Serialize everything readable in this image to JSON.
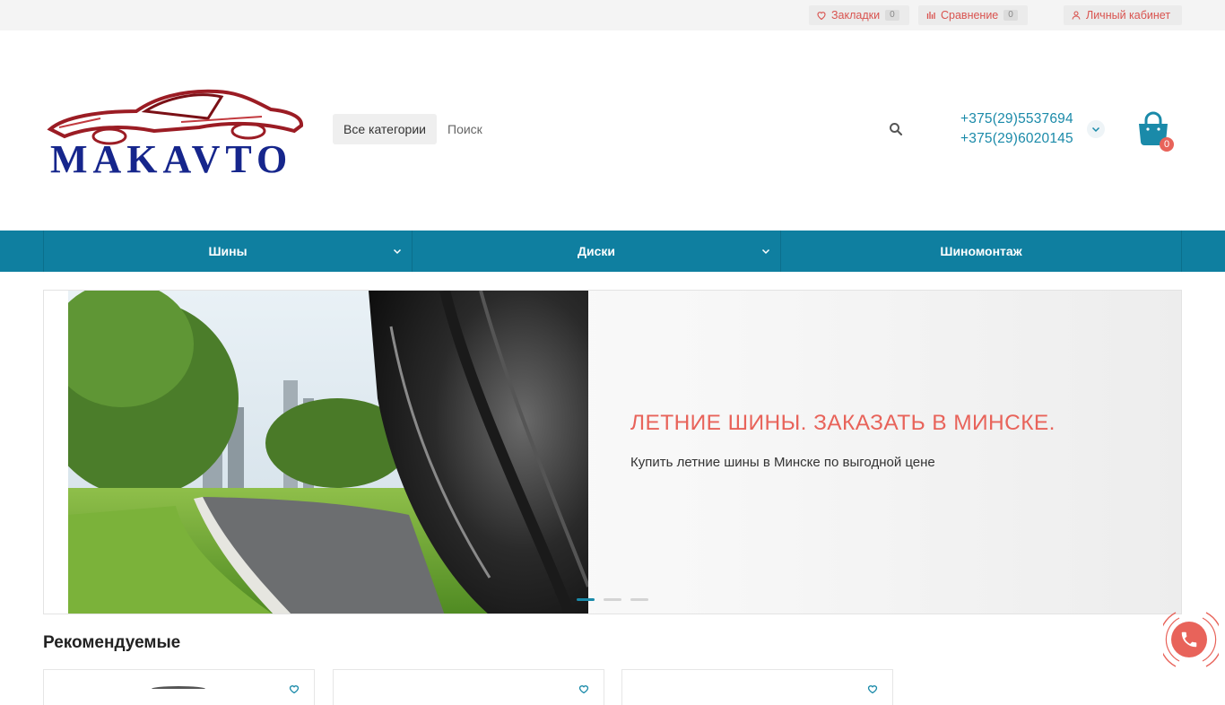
{
  "topbar": {
    "bookmarks_label": "Закладки",
    "bookmarks_count": "0",
    "compare_label": "Сравнение",
    "compare_count": "0",
    "account_label": "Личный кабинет",
    "link_color": "#d9534f"
  },
  "header": {
    "logo_text": "MAKAVTO",
    "category_button": "Все категории",
    "search_placeholder": "Поиск",
    "phone_1": "+375(29)5537694",
    "phone_2": "+375(29)6020145",
    "cart_count": "0",
    "accent_color": "#1a8aa9"
  },
  "nav": {
    "items": [
      {
        "label": "Шины",
        "has_dropdown": true
      },
      {
        "label": "Диски",
        "has_dropdown": true
      },
      {
        "label": "Шиномонтаж",
        "has_dropdown": false
      }
    ],
    "background_color": "#0f7fa0"
  },
  "slider": {
    "title": "ЛЕТНИЕ ШИНЫ. ЗАКАЗАТЬ В МИНСКЕ.",
    "text": "Купить летние шины в Минске по выгодной цене",
    "slide_count": 3,
    "active_slide": 1,
    "title_color": "#e8635a"
  },
  "recommended": {
    "title": "Рекомендуемые"
  },
  "icons": {
    "bookmarks": "heart-icon",
    "compare": "bar-chart-icon",
    "account": "user-icon",
    "search": "search-icon",
    "phone_toggle": "chevron-down-icon",
    "cart": "shopping-bag-icon",
    "call": "phone-icon"
  }
}
